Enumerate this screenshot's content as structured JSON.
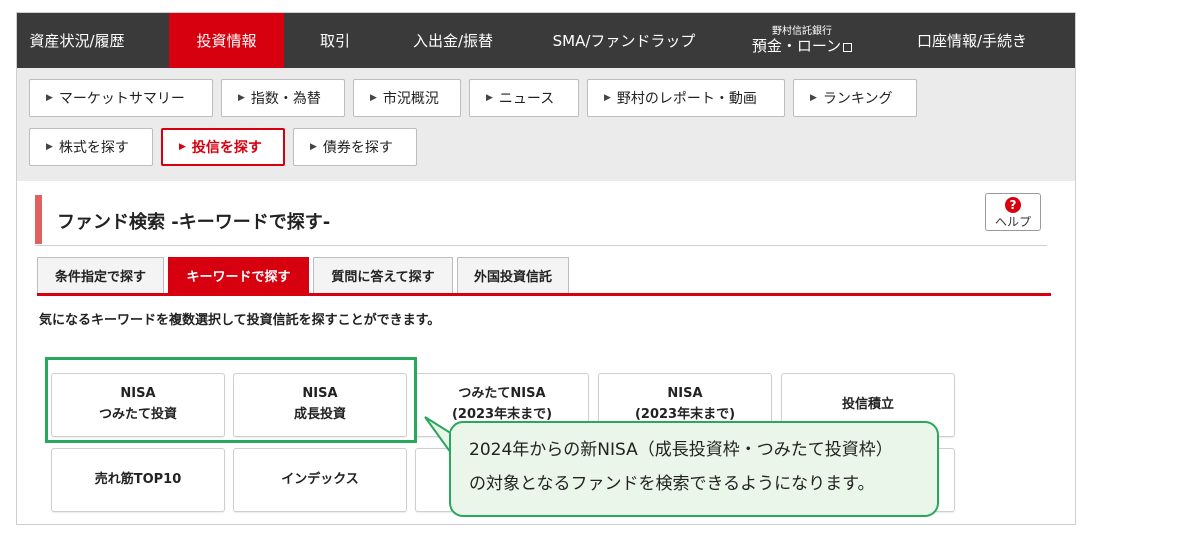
{
  "topnav": {
    "items": [
      {
        "label": "資産状況/履歴"
      },
      {
        "label": "投資情報"
      },
      {
        "label": "取引"
      },
      {
        "label": "入出金/振替"
      },
      {
        "label": "SMA/ファンドラップ"
      },
      {
        "small": "野村信託銀行",
        "label": "預金・ローン"
      },
      {
        "label": "口座情報/手続き"
      }
    ]
  },
  "subnav": {
    "items": [
      {
        "label": "マーケットサマリー"
      },
      {
        "label": "指数・為替"
      },
      {
        "label": "市況概況"
      },
      {
        "label": "ニュース"
      },
      {
        "label": "野村のレポート・動画"
      },
      {
        "label": "ランキング"
      },
      {
        "label": "株式を探す"
      },
      {
        "label": "投信を探す"
      },
      {
        "label": "債券を探す"
      }
    ]
  },
  "page": {
    "title": "ファンド検索 -キーワードで探す-",
    "help_label": "ヘルプ",
    "description": "気になるキーワードを複数選択して投資信託を探すことができます。"
  },
  "tabs": [
    {
      "label": "条件指定で探す"
    },
    {
      "label": "キーワードで探す"
    },
    {
      "label": "質問に答えて探す"
    },
    {
      "label": "外国投資信託"
    }
  ],
  "keywords": [
    {
      "line1": "NISA",
      "line2": "つみたて投資"
    },
    {
      "line1": "NISA",
      "line2": "成長投資"
    },
    {
      "line1": "つみたてNISA",
      "line2": "(2023年末まで)"
    },
    {
      "line1": "NISA",
      "line2": "(2023年末まで)"
    },
    {
      "line1": "投信積立",
      "line2": ""
    },
    {
      "line1": "売れ筋TOP10",
      "line2": ""
    },
    {
      "line1": "インデックス",
      "line2": ""
    }
  ],
  "callout": {
    "line1": "2024年からの新NISA（成長投資枠・つみたて投資枠）",
    "line2": "の対象となるファンドを検索できるようになります。"
  },
  "colors": {
    "accent_red": "#d7000f",
    "nav_dark": "#3a3a3a",
    "highlight_green": "#27a85b"
  }
}
